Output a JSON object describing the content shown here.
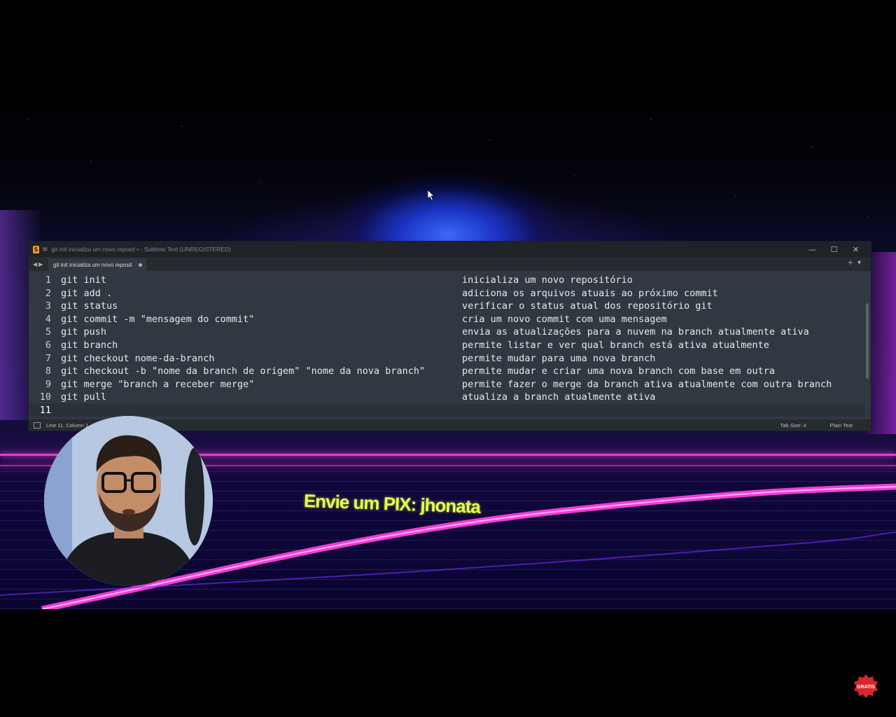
{
  "window": {
    "title": "git init inicializa um novo reposit • - Sublime Text (UNREGISTERED)",
    "minimize": "—",
    "maximize": "☐",
    "close": "✕"
  },
  "tabs": [
    {
      "label": "git init inicializa um novo reposit",
      "modified": true
    }
  ],
  "editor": {
    "line_numbers": [
      "1",
      "2",
      "3",
      "4",
      "5",
      "6",
      "7",
      "8",
      "9",
      "10",
      "11"
    ],
    "commands": [
      "git init",
      "git add .",
      "git status",
      "git commit -m \"mensagem do commit\"",
      "git push",
      "git branch",
      "git checkout nome-da-branch",
      "git checkout -b \"nome da branch de origem\" \"nome da nova branch\"",
      "git merge \"branch a receber merge\"",
      "git pull",
      ""
    ],
    "descriptions": [
      "inicializa um novo repositório",
      "adiciona os arquivos atuais ao próximo commit",
      "verificar o status atual dos repositório git",
      "cria um novo commit com uma mensagem",
      "envia as atualizações para a nuvem na branch atualmente ativa",
      "permite listar e ver qual branch está ativa atualmente",
      "permite mudar para uma nova branch",
      "permite mudar e criar uma nova branch com base em outra",
      "permite fazer o merge da branch ativa atualmente com outra branch",
      "atualiza a branch atualmente ativa",
      ""
    ]
  },
  "statusbar": {
    "position": "Line 11, Column 1",
    "tab_size": "Tab Size: 4",
    "syntax": "Plain Text"
  },
  "overlay": {
    "pix_text": "Envie um PIX: jhonata",
    "badge_text": "GRATIS"
  },
  "icons": {
    "app": "sublime-text-icon",
    "menu": "hamburger-icon",
    "nav": "arrow-left-right-icon",
    "new_tab": "plus-icon",
    "tab_list": "chevron-down-icon",
    "cursor": "mouse-cursor-icon"
  },
  "colors": {
    "editor_bg": "#303841",
    "titlebar_bg": "#1f2327",
    "pix_text": "#e6ff4d",
    "neon_pink": "#ff4fd8"
  }
}
